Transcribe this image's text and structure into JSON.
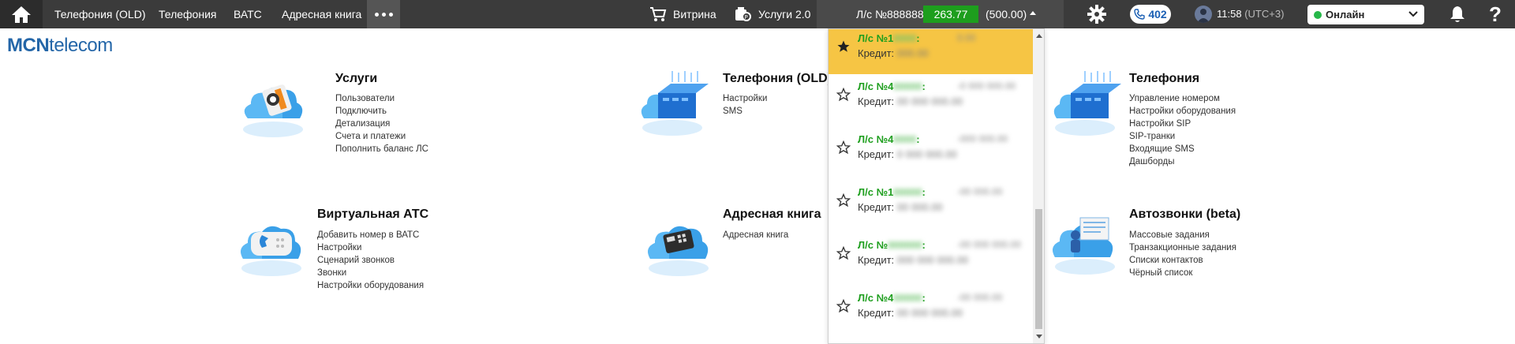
{
  "nav": {
    "items": [
      "Телефония (OLD)",
      "Телефония",
      "ВАТС",
      "Адресная книга"
    ]
  },
  "topbar": {
    "showcase_label": "Витрина",
    "services2_label": "Услуги 2.0",
    "account_label": "Л/с №888888:",
    "balance": "263.77",
    "credit": "(500.00)",
    "calls_count": "402",
    "time": "11:58",
    "timezone": "(UTC+3)",
    "status": "Онлайн",
    "help": "?"
  },
  "logo": {
    "bold": "MCN",
    "rest": "telecom"
  },
  "services": [
    {
      "title": "Услуги",
      "links": [
        "Пользователи",
        "Подключить",
        "Детализация",
        "Счета и платежи",
        "Пополнить баланс ЛС"
      ]
    },
    {
      "title": "Телефония (OLD)",
      "links": [
        "Настройки",
        "SMS"
      ]
    },
    {
      "title": "Телефония",
      "links": [
        "Управление номером",
        "Настройки оборудования",
        "Настройки SIP",
        "SIP-транки",
        "Входящие SMS",
        "Дашборды"
      ]
    },
    {
      "title": "Виртуальная АТС",
      "links": [
        "Добавить номер в ВАТС",
        "Настройки",
        "Сценарий звонков",
        "Звонки",
        "Настройки оборудования"
      ]
    },
    {
      "title": "Адресная книга",
      "links": [
        "Адресная книга"
      ]
    },
    {
      "title": "Автозвонки (beta)",
      "links": [
        "Массовые задания",
        "Транзакционные задания",
        "Списки контактов",
        "Чёрный список"
      ]
    }
  ],
  "dropdown": {
    "credit_label": "Кредит:",
    "items": [
      {
        "prefix": "Л/с №1",
        "active": true
      },
      {
        "prefix": "Л/с №4",
        "active": false
      },
      {
        "prefix": "Л/с №4",
        "active": false
      },
      {
        "prefix": "Л/с №1",
        "active": false
      },
      {
        "prefix": "Л/с №",
        "active": false
      },
      {
        "prefix": "Л/с №4",
        "active": false
      }
    ]
  },
  "colors": {
    "topbar": "#3b3b3b",
    "balance_green": "#1d9e1d",
    "active_item": "#f6c544",
    "logo_blue": "#2466a8",
    "status_online": "#27b84a"
  }
}
